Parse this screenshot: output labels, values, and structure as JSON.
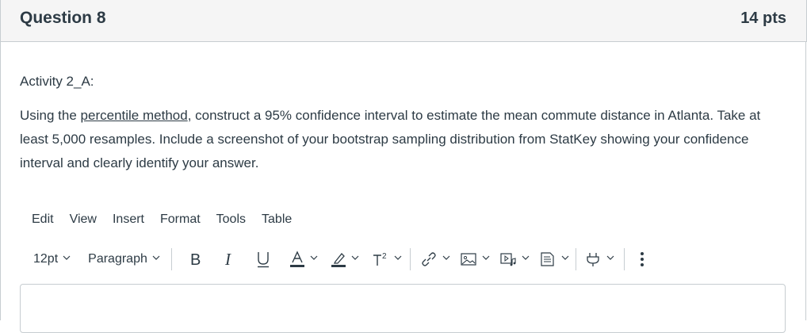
{
  "question": {
    "title": "Question 8",
    "points": "14 pts",
    "label": "Activity 2_A:",
    "text_before_link": "Using the ",
    "link_text": "percentile method",
    "text_after_link": ", construct a 95% confidence interval to estimate the mean commute distance in Atlanta. Take at least 5,000 resamples. Include a screenshot of your bootstrap sampling distribution from StatKey showing your confidence interval and clearly identify your answer."
  },
  "editor": {
    "menu": [
      "Edit",
      "View",
      "Insert",
      "Format",
      "Tools",
      "Table"
    ],
    "font_size": "12pt",
    "block_format": "Paragraph",
    "icons": [
      "bold-icon",
      "italic-icon",
      "underline-icon",
      "text-color-icon",
      "highlight-icon",
      "superscript-icon",
      "link-icon",
      "image-icon",
      "media-icon",
      "document-icon",
      "plugin-icon",
      "more-icon"
    ]
  }
}
